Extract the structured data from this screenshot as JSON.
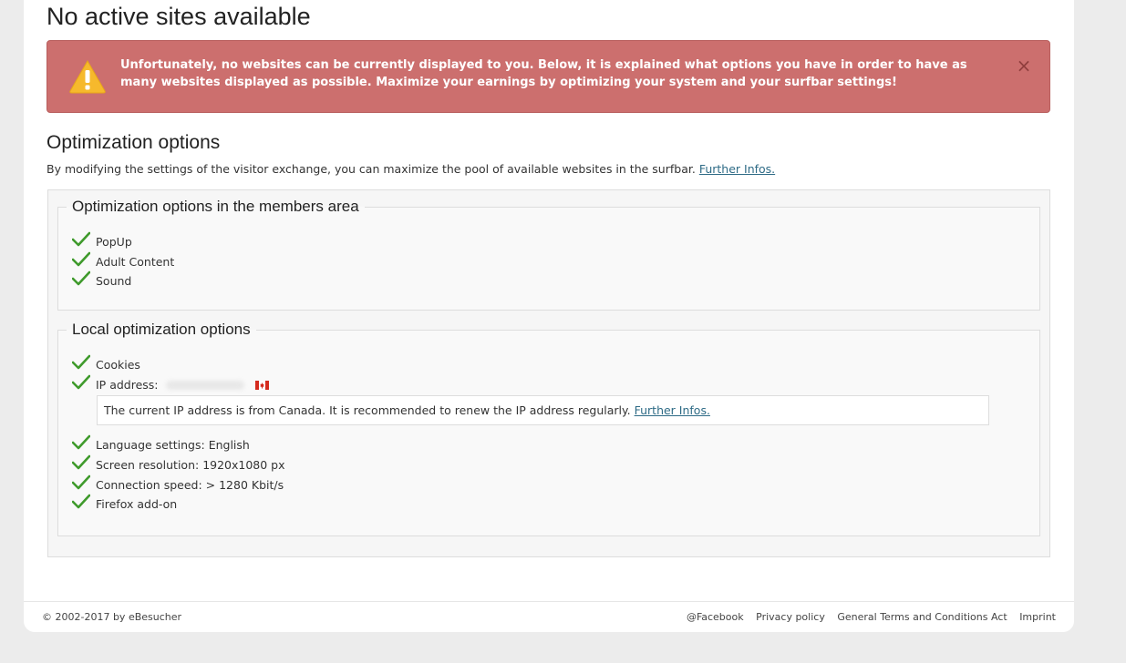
{
  "page": {
    "title": "No active sites available"
  },
  "alert": {
    "icon": "warning-icon",
    "message": "Unfortunately, no websites can be currently displayed to you. Below, it is explained what options you have in order to have as many websites displayed as possible. Maximize your earnings by optimizing your system and your surfbar settings!",
    "close_label": "×",
    "background_color": "#cc6f6e"
  },
  "optimization": {
    "title": "Optimization options",
    "intro_text": "By modifying the settings of the visitor exchange, you can maximize the pool of available websites in the surfbar.",
    "intro_link": "Further Infos.",
    "members_area": {
      "legend": "Optimization options in the members area",
      "items": [
        {
          "label": "PopUp",
          "icon": "checkmark-icon"
        },
        {
          "label": "Adult Content",
          "icon": "checkmark-icon"
        },
        {
          "label": "Sound",
          "icon": "checkmark-icon"
        }
      ]
    },
    "local": {
      "legend": "Local optimization options",
      "items": [
        {
          "label": "Cookies",
          "icon": "checkmark-icon"
        },
        {
          "label": "IP address:",
          "icon": "checkmark-icon",
          "flag": "canada-flag-icon"
        },
        {
          "label": "Language settings: English",
          "icon": "checkmark-icon"
        },
        {
          "label": "Screen resolution: 1920x1080 px",
          "icon": "checkmark-icon"
        },
        {
          "label": "Connection speed: > 1280 Kbit/s",
          "icon": "checkmark-icon"
        },
        {
          "label": "Firefox add-on",
          "icon": "checkmark-icon"
        }
      ],
      "ip_note_text": "The current IP address is from Canada. It is recommended to renew the IP address regularly.",
      "ip_note_link": "Further Infos."
    },
    "check_color": "#3f9a2c"
  },
  "footer": {
    "copyright": "© 2002-2017 by eBesucher",
    "links": [
      "@Facebook",
      "Privacy policy",
      "General Terms and Conditions Act",
      "Imprint"
    ]
  }
}
